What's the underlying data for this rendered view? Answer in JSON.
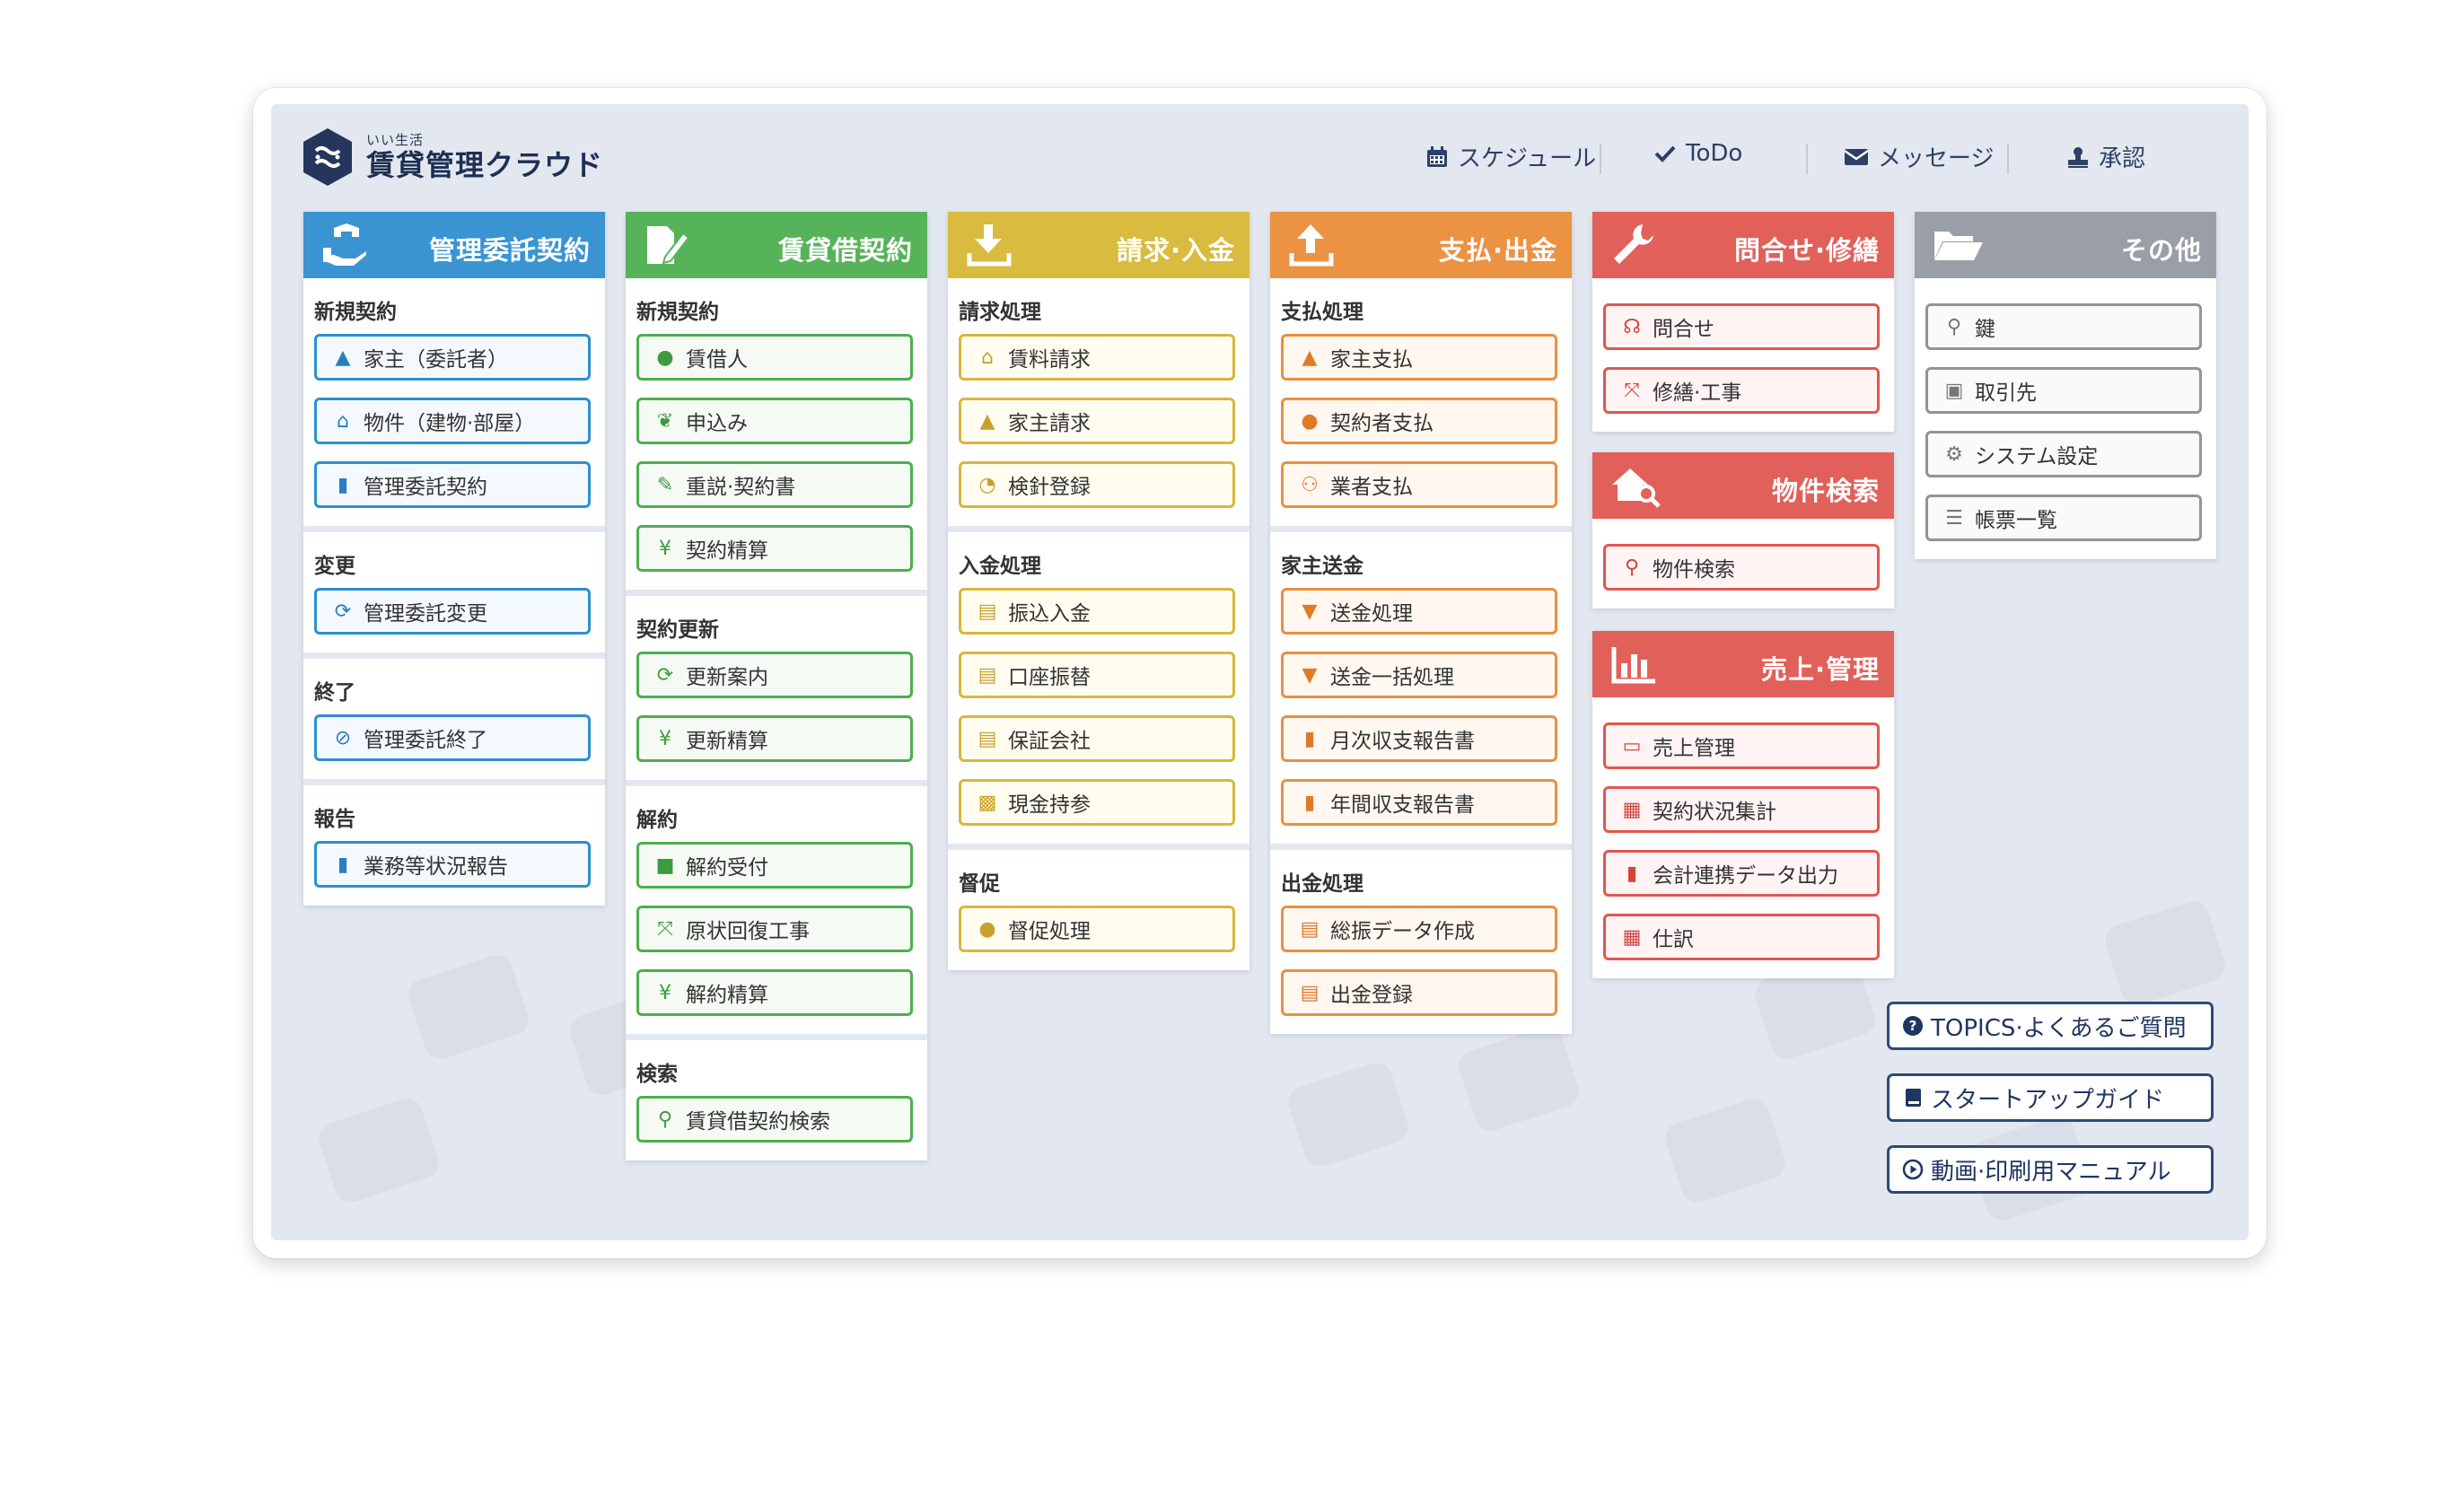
{
  "app": {
    "logo_sub": "いい生活",
    "logo_title": "賃貸管理クラウド"
  },
  "topnav": [
    {
      "label": "スケジュール",
      "icon": "calendar-icon"
    },
    {
      "label": "ToDo",
      "icon": "check-icon"
    },
    {
      "label": "メッセージ",
      "icon": "envelope-icon"
    },
    {
      "label": "承認",
      "icon": "stamp-icon"
    }
  ],
  "colors": {
    "blue": "#3a94d2",
    "green": "#57b35a",
    "yellow": "#d8bb3f",
    "orange": "#eb9243",
    "red": "#e2605a",
    "gray": "#9a9ea6",
    "navy": "#1d2f52"
  },
  "columns": {
    "kanri": {
      "title": "管理委託契約",
      "sections": [
        {
          "title": "新規契約",
          "items": [
            "家主（委託者）",
            "物件（建物·部屋）",
            "管理委託契約"
          ]
        },
        {
          "title": "変更",
          "items": [
            "管理委託変更"
          ]
        },
        {
          "title": "終了",
          "items": [
            "管理委託終了"
          ]
        },
        {
          "title": "報告",
          "items": [
            "業務等状況報告"
          ]
        }
      ]
    },
    "chintai": {
      "title": "賃貸借契約",
      "sections": [
        {
          "title": "新規契約",
          "items": [
            "賃借人",
            "申込み",
            "重説·契約書",
            "契約精算"
          ]
        },
        {
          "title": "契約更新",
          "items": [
            "更新案内",
            "更新精算"
          ]
        },
        {
          "title": "解約",
          "items": [
            "解約受付",
            "原状回復工事",
            "解約精算"
          ]
        },
        {
          "title": "検索",
          "items": [
            "賃貸借契約検索"
          ]
        }
      ]
    },
    "seikyu": {
      "title": "請求·入金",
      "sections": [
        {
          "title": "請求処理",
          "items": [
            "賃料請求",
            "家主請求",
            "検針登録"
          ]
        },
        {
          "title": "入金処理",
          "items": [
            "振込入金",
            "口座振替",
            "保証会社",
            "現金持参"
          ]
        },
        {
          "title": "督促",
          "items": [
            "督促処理"
          ]
        }
      ]
    },
    "shiharai": {
      "title": "支払·出金",
      "sections": [
        {
          "title": "支払処理",
          "items": [
            "家主支払",
            "契約者支払",
            "業者支払"
          ]
        },
        {
          "title": "家主送金",
          "items": [
            "送金処理",
            "送金一括処理",
            "月次収支報告書",
            "年間収支報告書"
          ]
        },
        {
          "title": "出金処理",
          "items": [
            "総振データ作成",
            "出金登録"
          ]
        }
      ]
    },
    "toiawase": {
      "title": "問合せ·修繕",
      "items": [
        "問合せ",
        "修繕·工事"
      ]
    },
    "bukken": {
      "title": "物件検索",
      "items": [
        "物件検索"
      ]
    },
    "uriage": {
      "title": "売上·管理",
      "items": [
        "売上管理",
        "契約状況集計",
        "会計連携データ出力",
        "仕訳"
      ]
    },
    "sonota": {
      "title": "その他",
      "items": [
        "鍵",
        "取引先",
        "システム設定",
        "帳票一覧"
      ]
    }
  },
  "side_links": [
    "TOPICS·よくあるご質問",
    "スタートアップガイド",
    "動画·印刷用マニュアル"
  ]
}
